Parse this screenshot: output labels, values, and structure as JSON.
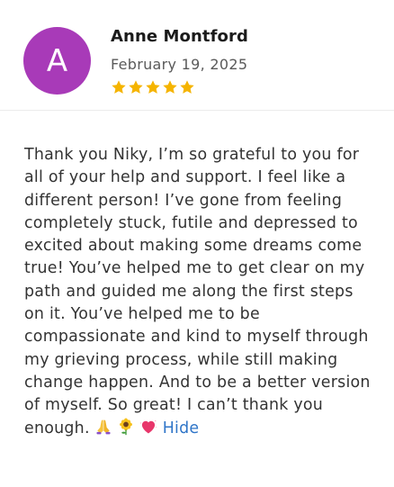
{
  "reviewer": {
    "initial": "A",
    "name": "Anne Montford",
    "date": "February 19, 2025",
    "rating": 5,
    "avatar_color": "#a83ab8"
  },
  "review": {
    "text": "Thank you Niky, I’m so grateful to you for all of your help and support. I feel like a different person! I’ve gone from feeling completely stuck, futile and depressed to excited about making some dreams come true! You’ve helped me to get clear on my path and guided me along the first steps on it. You’ve helped me to be compassionate and kind to myself through my grieving process, while still making change happen. And to be a better version of myself. So great! I can’t thank you enough.",
    "emojis": [
      "praying-hands-icon",
      "sunflower-icon",
      "heart-icon"
    ],
    "hide_label": "Hide"
  },
  "colors": {
    "star": "#f5b400",
    "link": "#2f75c8"
  }
}
